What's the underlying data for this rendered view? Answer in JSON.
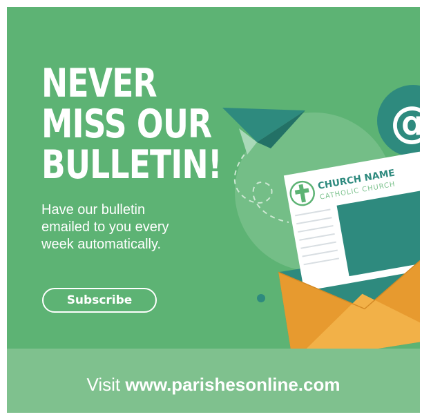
{
  "headline": {
    "line1": "NEVER",
    "line2": "MISS OUR",
    "line3": "BULLETIN!"
  },
  "subtext": {
    "line1": "Have our bulletin",
    "line2": "emailed to you every",
    "line3": "week automatically."
  },
  "subscribe_label": "Subscribe",
  "bulletin": {
    "church_name": "CHURCH NAME",
    "church_type": "CATHOLIC CHURCH"
  },
  "email_badge_symbol": "@",
  "footer": {
    "prefix": "Visit",
    "url": "www.parishesonline.com"
  },
  "colors": {
    "background_green": "#5db374",
    "footer_green": "#7fc18e",
    "dark_teal": "#2e8a7e",
    "envelope_orange": "#eea63a",
    "white": "#ffffff"
  },
  "icons": [
    "paper-plane-icon",
    "at-sign-icon",
    "cross-icon",
    "envelope-icon"
  ]
}
